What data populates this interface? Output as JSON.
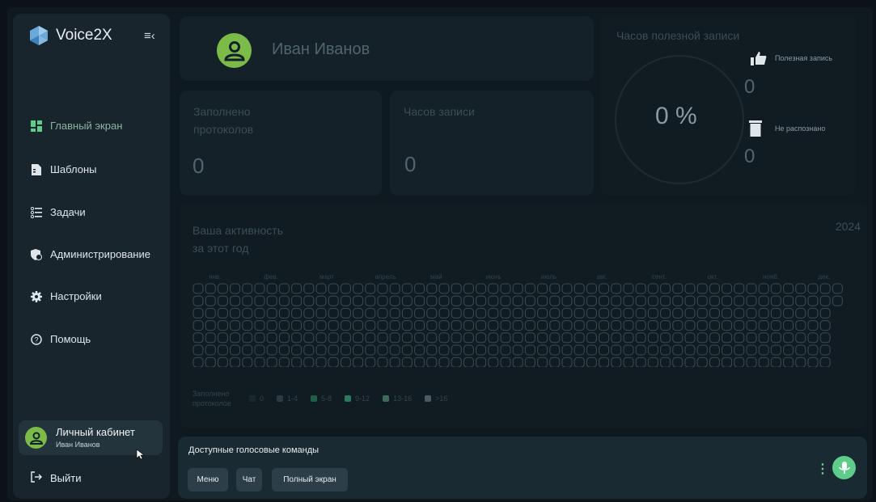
{
  "app": {
    "name": "Voice2X"
  },
  "sidebar": {
    "items": [
      {
        "label": "Главный экран",
        "icon": "dashboard-icon",
        "active": true
      },
      {
        "label": "Шаблоны",
        "icon": "template-icon"
      },
      {
        "label": "Задачи",
        "icon": "tasks-icon"
      },
      {
        "label": "Администрирование",
        "icon": "admin-icon"
      },
      {
        "label": "Настройки",
        "icon": "gear-icon"
      },
      {
        "label": "Помощь",
        "icon": "help-icon"
      }
    ],
    "account": {
      "title": "Личный кабинет",
      "name": "Иван Иванов"
    },
    "logout_label": "Выйти"
  },
  "profile": {
    "name": "Иван Иванов"
  },
  "stats": {
    "protocols": {
      "title": "Заполнено протоколов",
      "value": "0"
    },
    "hours": {
      "title": "Часов записи",
      "value": "0"
    }
  },
  "useful": {
    "title": "Часов полезной записи",
    "percent": "0 %",
    "useful_label": "Полезная запись",
    "useful_value": "0",
    "unrecognized_label": "Не распознано",
    "unrecognized_value": "0"
  },
  "activity": {
    "title_line1": "Ваша активность",
    "title_line2": "за этот год",
    "year": "2024",
    "months": [
      "янв.",
      "фев.",
      "март",
      "апрель",
      "май",
      "июнь",
      "июль",
      "авг.",
      "сент.",
      "окт.",
      "нояб.",
      "дек."
    ],
    "legend_title": "Заполнено протоколов",
    "legend": [
      {
        "label": "0",
        "color": "#1a272d"
      },
      {
        "label": "1-4",
        "color": "#2c3b42"
      },
      {
        "label": "5-8",
        "color": "#1f5f4a"
      },
      {
        "label": "9-12",
        "color": "#2b7a5d"
      },
      {
        "label": "13-16",
        "color": "#3b6b5c"
      },
      {
        "label": ">16",
        "color": "#4a5a62"
      }
    ]
  },
  "voice": {
    "title": "Доступные голосовые команды",
    "commands": [
      "Меню",
      "Чат",
      "Полный экран"
    ]
  },
  "colors": {
    "accent": "#7dbb49",
    "mic": "#5fcc8a",
    "background": "#0c1318"
  }
}
